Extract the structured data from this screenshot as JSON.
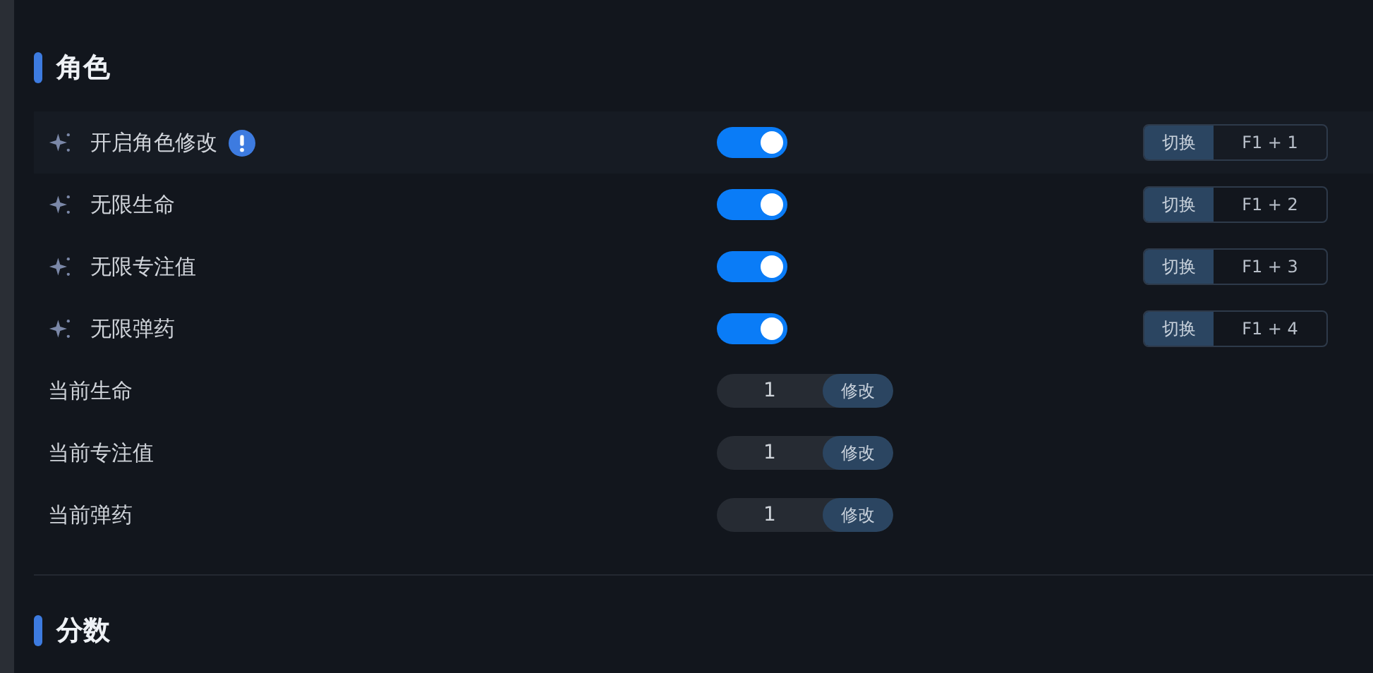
{
  "sections": [
    {
      "title": "角色",
      "rows": [
        {
          "kind": "toggle",
          "label": "开启角色修改",
          "info": true,
          "highlighted": true,
          "on": true,
          "hotkey_action": "切换",
          "hotkey": "F1 + 1"
        },
        {
          "kind": "toggle",
          "label": "无限生命",
          "info": false,
          "highlighted": false,
          "on": true,
          "hotkey_action": "切换",
          "hotkey": "F1 + 2"
        },
        {
          "kind": "toggle",
          "label": "无限专注值",
          "info": false,
          "highlighted": false,
          "on": true,
          "hotkey_action": "切换",
          "hotkey": "F1 + 3"
        },
        {
          "kind": "toggle",
          "label": "无限弹药",
          "info": false,
          "highlighted": false,
          "on": true,
          "hotkey_action": "切换",
          "hotkey": "F1 + 4"
        },
        {
          "kind": "number",
          "label": "当前生命",
          "value": "1",
          "button": "修改"
        },
        {
          "kind": "number",
          "label": "当前专注值",
          "value": "1",
          "button": "修改"
        },
        {
          "kind": "number",
          "label": "当前弹药",
          "value": "1",
          "button": "修改"
        }
      ]
    },
    {
      "title": "分数"
    }
  ]
}
